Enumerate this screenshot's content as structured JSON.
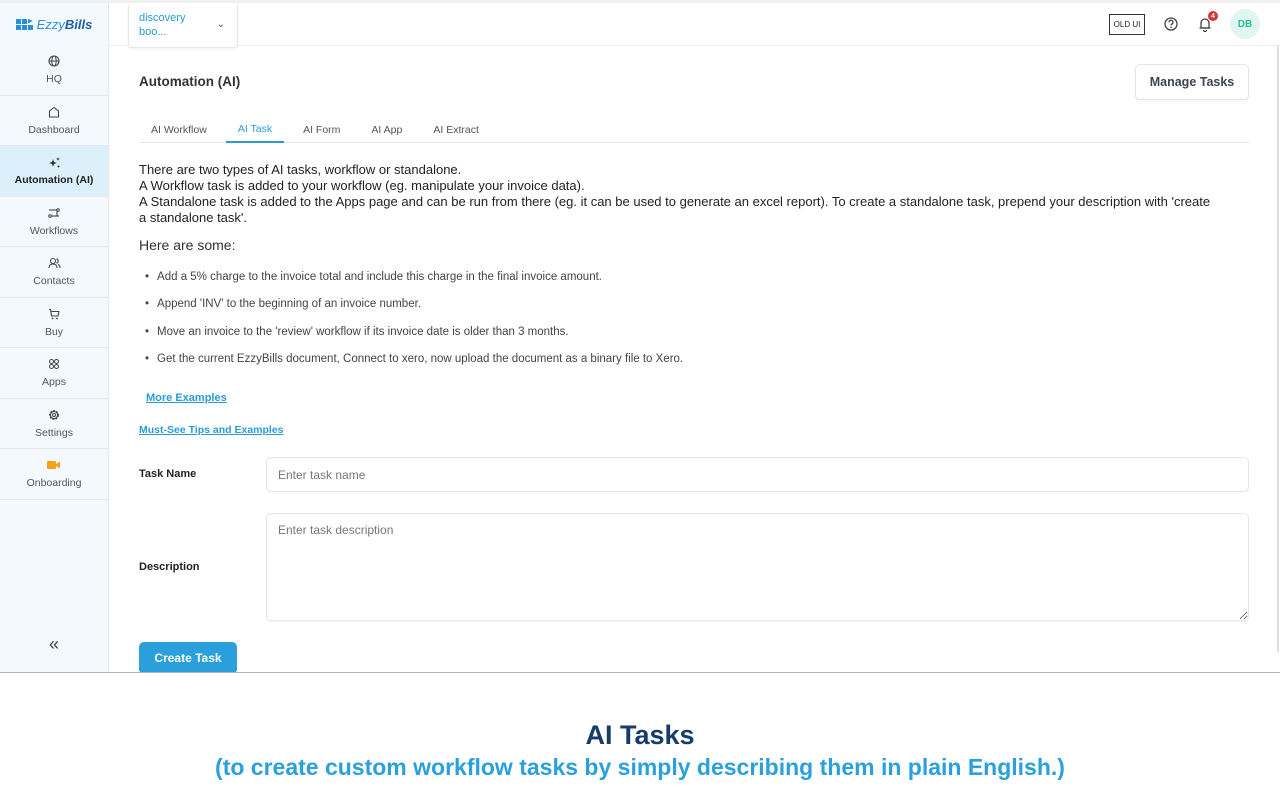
{
  "app": {
    "logo_text_light": "Ezzy",
    "logo_text_bold": "Bills",
    "brand_color": "#2a9ad8"
  },
  "sidebar": {
    "items": [
      {
        "label": "HQ",
        "icon": "globe-icon"
      },
      {
        "label": "Dashboard",
        "icon": "home-icon"
      },
      {
        "label": "Automation (AI)",
        "icon": "sparkles-icon",
        "active": true
      },
      {
        "label": "Workflows",
        "icon": "workflow-icon"
      },
      {
        "label": "Contacts",
        "icon": "users-icon"
      },
      {
        "label": "Buy",
        "icon": "cart-icon"
      },
      {
        "label": "Apps",
        "icon": "apps-icon"
      },
      {
        "label": "Settings",
        "icon": "gear-icon"
      },
      {
        "label": "Onboarding",
        "icon": "video-icon"
      }
    ],
    "collapse_label": "«"
  },
  "header": {
    "org_name": "discovery boo...",
    "org_chevron": "⌄",
    "old_ui_label": "OLD UI",
    "notification_count": "4",
    "avatar_initials": "DB"
  },
  "main": {
    "title": "Automation (AI)",
    "manage_tasks_label": "Manage Tasks",
    "tabs": [
      {
        "label": "AI Workflow"
      },
      {
        "label": "AI Task",
        "active": true
      },
      {
        "label": "AI Form"
      },
      {
        "label": "AI App"
      },
      {
        "label": "AI Extract"
      }
    ],
    "intro": [
      "There are two types of AI tasks, workflow or standalone.",
      "A Workflow task is added to your workflow (eg. manipulate your invoice data).",
      "A Standalone task is added to the Apps page and can be run from there (eg. it can be used to generate an excel report). To create a standalone task, prepend your description with 'create a standalone task'."
    ],
    "examples_heading": "Here are some:",
    "examples": [
      "Add a 5% charge to the invoice total and include this charge in the final invoice amount.",
      "Append 'INV' to the beginning of an invoice number.",
      "Move an invoice to the 'review' workflow if its invoice date is older than 3 months.",
      "Get the current EzzyBills document, Connect to xero, now upload the document as a binary file to Xero."
    ],
    "more_examples_link": "More Examples",
    "tips_link": "Must-See Tips and Examples",
    "form": {
      "task_name_label": "Task Name",
      "task_name_placeholder": "Enter task name",
      "task_name_value": "",
      "description_label": "Description",
      "description_placeholder": "Enter task description",
      "description_value": "",
      "create_button_label": "Create Task"
    }
  },
  "caption": {
    "title": "AI Tasks",
    "subtitle": "(to create custom workflow tasks by simply describing them in plain English.)"
  }
}
